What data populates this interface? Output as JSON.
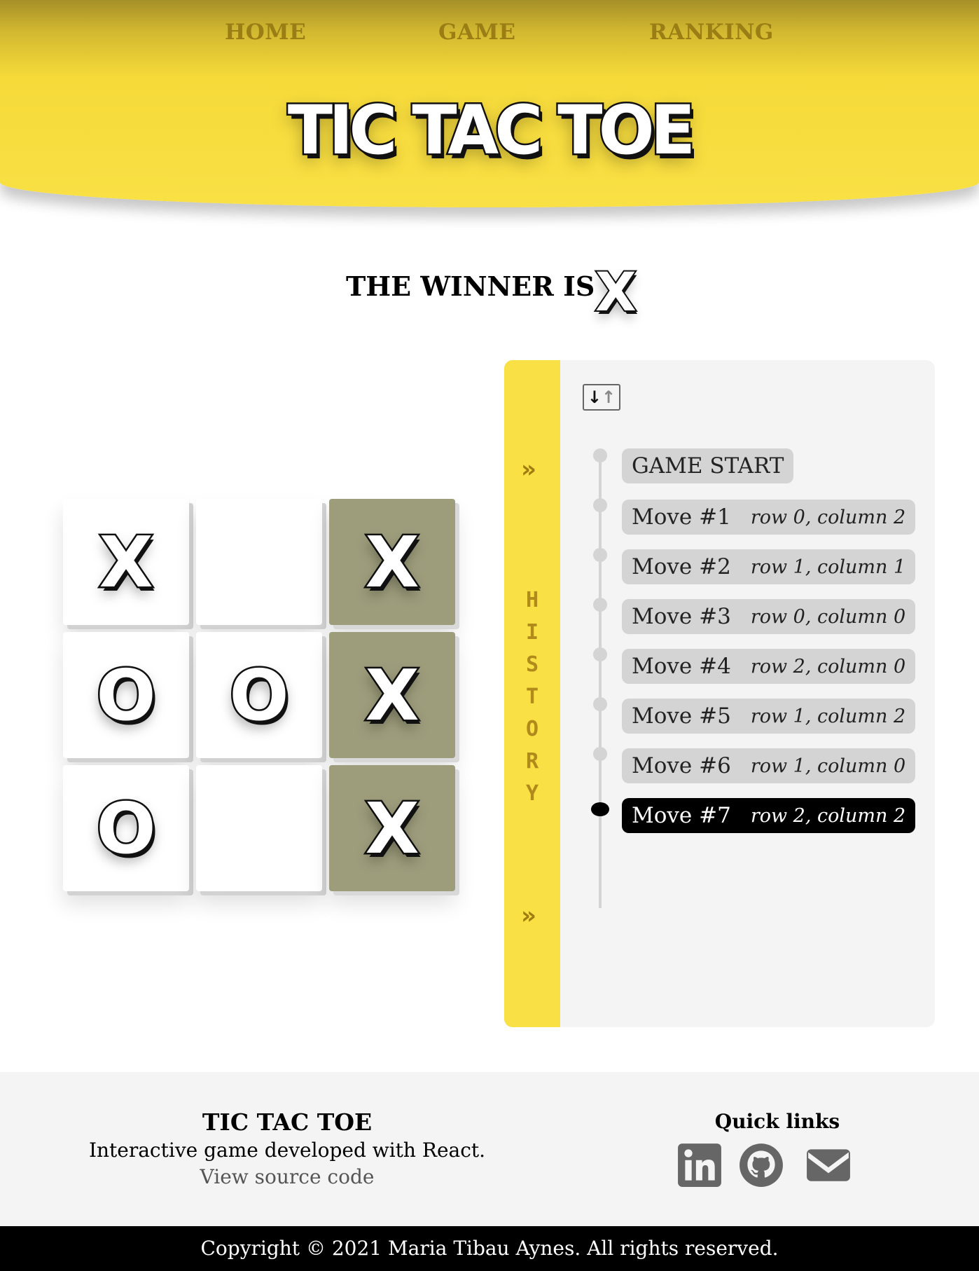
{
  "nav": {
    "home": "HOME",
    "game": "GAME",
    "ranking": "RANKING"
  },
  "header": {
    "title": "TIC TAC TOE"
  },
  "status": {
    "label": "THE WINNER IS",
    "winner": "X"
  },
  "board": {
    "cells": [
      "X",
      "",
      "X",
      "O",
      "O",
      "X",
      "O",
      "",
      "X"
    ],
    "winning_cells": [
      2,
      5,
      8
    ],
    "win_color": "#9d9c7b"
  },
  "history": {
    "label": "HISTORY",
    "expand_icon": "double-chevron-right-icon",
    "sort_icon": "sort-arrows-icon",
    "moves": [
      {
        "label": "GAME START",
        "pos": ""
      },
      {
        "label": "Move #1",
        "pos": "row 0, column 2"
      },
      {
        "label": "Move #2",
        "pos": "row 1, column 1"
      },
      {
        "label": "Move #3",
        "pos": "row 0, column 0"
      },
      {
        "label": "Move #4",
        "pos": "row 2, column 0"
      },
      {
        "label": "Move #5",
        "pos": "row 1, column 2"
      },
      {
        "label": "Move #6",
        "pos": "row 1, column 0"
      },
      {
        "label": "Move #7",
        "pos": "row 2, column 2"
      }
    ],
    "active_index": 7
  },
  "footer": {
    "title": "TIC TAC TOE",
    "description": "Interactive game developed with React.",
    "source_link": "View source code",
    "quick_links_title": "Quick links",
    "icons": [
      "linkedin-icon",
      "github-icon",
      "mail-icon"
    ],
    "copyright": "Copyright © 2021 Maria Tibau Aynes. All rights reserved."
  },
  "colors": {
    "header_yellow": "#f9e044",
    "nav_text": "#9a7d14",
    "panel_bg": "#f4f4f4",
    "move_bg": "#d4d4d4",
    "active_move_bg": "#000000"
  }
}
